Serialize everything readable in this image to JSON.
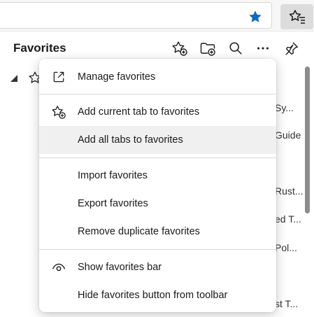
{
  "colors": {
    "accent": "#0f6cbd",
    "menu_background": "#ffffff",
    "hover_background": "#f0f0f0",
    "separator": "#d9d9d9",
    "panel_background": "#ffffff"
  },
  "toolbar": {
    "star_icon": "star-filled-icon",
    "favorites_icon": "favorites-list-icon"
  },
  "panel": {
    "title": "Favorites",
    "header_buttons": [
      {
        "icon": "add-favorite-icon"
      },
      {
        "icon": "add-folder-icon"
      },
      {
        "icon": "search-icon"
      },
      {
        "icon": "more-icon"
      },
      {
        "icon": "pin-icon"
      }
    ],
    "background_items": [
      "Sy...",
      "Guide",
      "Rust...",
      "ed T...",
      "Pol...",
      "st T..."
    ]
  },
  "menu": {
    "items": [
      {
        "label": "Manage favorites",
        "icon": "external-link-icon"
      },
      {
        "label": "Add current tab to favorites",
        "icon": "add-favorite-icon"
      },
      {
        "label": "Add all tabs to favorites",
        "icon": ""
      },
      {
        "label": "Import favorites",
        "icon": ""
      },
      {
        "label": "Export favorites",
        "icon": ""
      },
      {
        "label": "Remove duplicate favorites",
        "icon": ""
      },
      {
        "label": "Show favorites bar",
        "icon": "eye-icon"
      },
      {
        "label": "Hide favorites button from toolbar",
        "icon": ""
      }
    ]
  }
}
